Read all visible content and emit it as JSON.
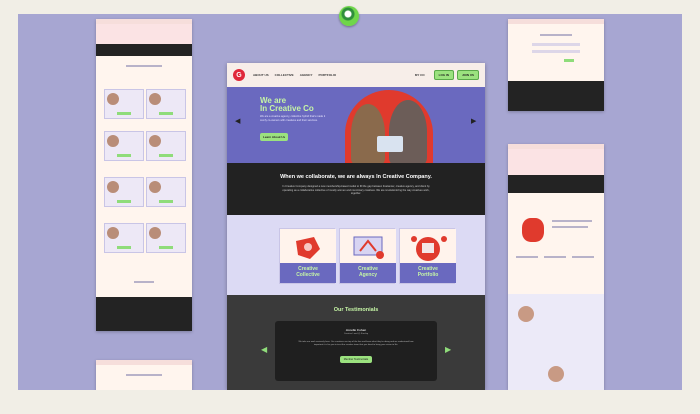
{
  "nav": {
    "logo_letter": "G",
    "items": [
      "ABOUT US",
      "COLLECTIVE",
      "AGENCY",
      "PORTFOLIO"
    ],
    "cart": "MY CO",
    "login_label": "LOG IN",
    "join_label": "JOIN US"
  },
  "hero": {
    "title_line1": "We are",
    "title_line2": "In Creative Co",
    "body": "We are a creative agency, collective hybrid that's made it comfy co-owners with creatives and their services.",
    "cta": "Learn About Us"
  },
  "collab": {
    "heading": "When we collaborate, we are always In Creative Company.",
    "body": "In Creative Company designed a new membership-based model to fill the gap between freelancer, creative agency, and client by operating as a collaborative collective of mostly women and non-binary creatives. We are revolutionizing the way creatives work, together."
  },
  "services": [
    {
      "line1": "Creative",
      "line2": "Collective"
    },
    {
      "line1": "Creative",
      "line2": "Agency"
    },
    {
      "line1": "Creative",
      "line2": "Portfolio"
    }
  ],
  "testimonials": {
    "heading": "Our Testimonials",
    "name": "Jonelle Cohen",
    "role": "Creative Lead @ Kinship",
    "quote": "We take our work seriously here. Our creatives are top of the line and know what they're doing and we understand how important it is for you to trust the creative team that you hired to bring your vision to life.",
    "more_label": "Member Testimonials"
  },
  "colors": {
    "board": "#a7a6d2",
    "hero": "#6a69bf",
    "accent_green": "#9be27f",
    "brand_red": "#e0283a",
    "dark": "#222222"
  },
  "icons": [
    "pin-icon",
    "arrow-left-icon",
    "arrow-right-icon"
  ]
}
